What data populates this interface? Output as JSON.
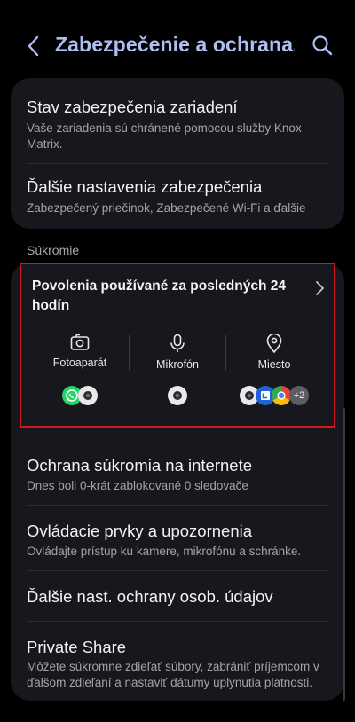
{
  "header": {
    "title": "Zabezpečenie a ochrana...",
    "back_icon": "chevron-left-icon",
    "search_icon": "search-icon"
  },
  "security_card": {
    "items": [
      {
        "title": "Stav zabezpečenia zariadení",
        "subtitle": "Vaše zariadenia sú chránené pomocou služby Knox Matrix."
      },
      {
        "title": "Ďalšie nastavenia zabezpečenia",
        "subtitle": "Zabezpečený priečinok, Zabezpečené Wi-Fi a ďalšie"
      }
    ]
  },
  "privacy": {
    "section_label": "Súkromie",
    "permissions": {
      "title": "Povolenia používané za posledných 24 hodín",
      "columns": [
        {
          "label": "Fotoaparát",
          "icon": "camera-icon",
          "apps": [
            "whatsapp-icon",
            "camera-app-icon"
          ]
        },
        {
          "label": "Mikrofón",
          "icon": "microphone-icon",
          "apps": [
            "camera-app-icon"
          ]
        },
        {
          "label": "Miesto",
          "icon": "location-pin-icon",
          "apps": [
            "camera-app-icon",
            "calendar-app-icon",
            "chrome-icon"
          ],
          "more": "+2"
        }
      ]
    },
    "items": [
      {
        "title": "Ochrana súkromia na internete",
        "subtitle": "Dnes boli 0-krát zablokované 0 sledovače"
      },
      {
        "title": "Ovládacie prvky a upozornenia",
        "subtitle": "Ovládajte prístup ku kamere, mikrofónu a schránke."
      },
      {
        "title": "Ďalšie nast. ochrany osob. údajov",
        "subtitle": ""
      },
      {
        "title": "Private Share",
        "subtitle": "Môžete súkromne zdieľať súbory, zabrániť príjemcom v ďalšom zdieľaní a nastaviť dátumy uplynutia platnosti."
      }
    ]
  },
  "colors": {
    "accent": "#aebff2",
    "card": "#16181d",
    "highlight": "#d3171e"
  }
}
